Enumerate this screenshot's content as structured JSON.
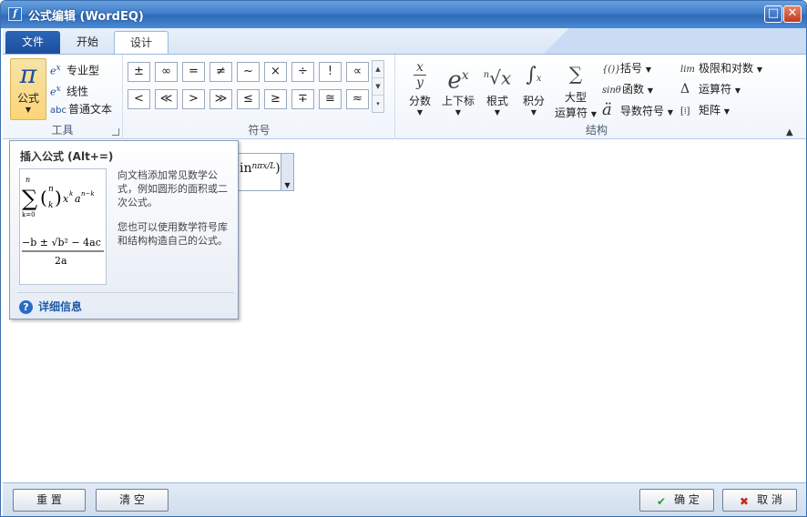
{
  "window": {
    "title": "公式编辑 (WordEQ)",
    "app_icon": "f",
    "max_glyph": "□",
    "close_glyph": "✕"
  },
  "tabs": [
    {
      "label": "文件"
    },
    {
      "label": "开始"
    },
    {
      "label": "设计"
    }
  ],
  "tools": {
    "formula_label": "公式",
    "formula_glyph": "π",
    "professional": "专业型",
    "linear": "线性",
    "plain_text": "普通文本",
    "group_label": "工具"
  },
  "symbols": {
    "items": [
      "±",
      "∞",
      "=",
      "≠",
      "~",
      "×",
      "÷",
      "!",
      "∝",
      "<",
      "≪",
      ">",
      "≫",
      "≤",
      "≥",
      "∓",
      "≅",
      "≈"
    ],
    "group_label": "符号"
  },
  "structures": {
    "fraction": "分数",
    "script": "上下标",
    "radical": "根式",
    "integral": "积分",
    "large_operator_1": "大型",
    "large_operator_2": "运算符",
    "bracket": "括号",
    "function": "函数",
    "accent": "导数符号",
    "limit_log": "极限和对数",
    "operator": "运算符",
    "matrix": "矩阵",
    "group_label": "结构",
    "function_icon": "sinθ",
    "limit_icon": "lim"
  },
  "editor": {
    "equation_text": "in"
  },
  "tooltip": {
    "title": "插入公式 (Alt+=)",
    "desc1": "向文档添加常见数学公式，例如圆形的面积或二次公式。",
    "desc2": "您也可以使用数学符号库和结构构造自己的公式。",
    "help": "详细信息",
    "help_icon": "?"
  },
  "bottom": {
    "reset": "重 置",
    "clear": "清 空",
    "ok": "确 定",
    "cancel": "取 消"
  },
  "colors": {
    "accent": "#2a65b8",
    "ok_icon": "#2e9a2e",
    "cancel_icon": "#c02a1a"
  }
}
